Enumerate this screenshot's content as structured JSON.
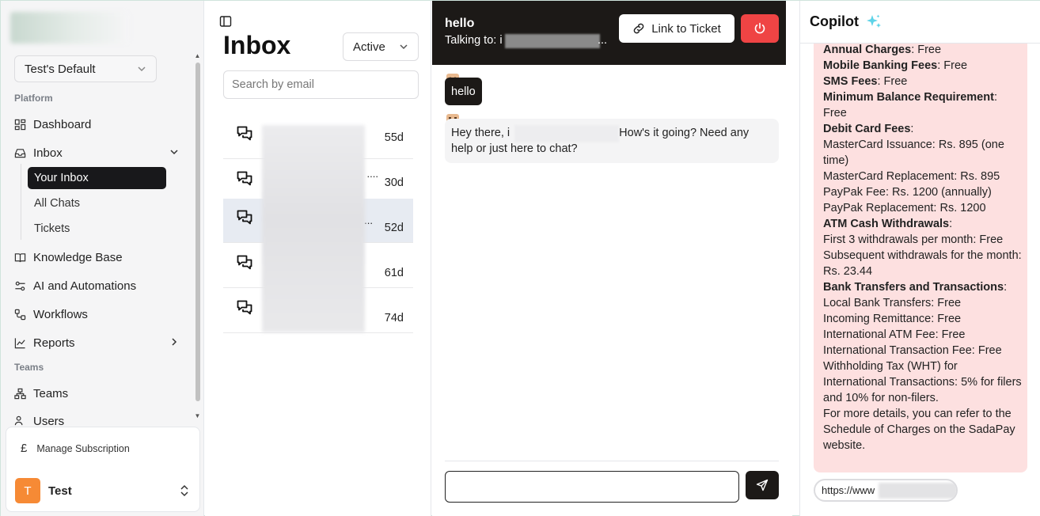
{
  "sidebar": {
    "workspace": "Test's Default",
    "platform_label": "Platform",
    "items": [
      {
        "label": "Dashboard"
      },
      {
        "label": "Inbox"
      },
      {
        "label": "Knowledge Base"
      },
      {
        "label": "AI and Automations"
      },
      {
        "label": "Workflows"
      },
      {
        "label": "Reports"
      }
    ],
    "inbox_sub": [
      {
        "label": "Your Inbox"
      },
      {
        "label": "All Chats"
      },
      {
        "label": "Tickets"
      }
    ],
    "teams_label": "Teams",
    "teams_items": [
      {
        "label": "Teams"
      },
      {
        "label": "Users"
      }
    ],
    "manage_subscription": "Manage Subscription",
    "user": {
      "initial": "T",
      "name": "Test"
    }
  },
  "inbox": {
    "title": "Inbox",
    "status_filter": "Active",
    "search_placeholder": "Search by email",
    "chats": [
      {
        "age": "55d",
        "truncated": ""
      },
      {
        "age": "30d",
        "truncated": "...."
      },
      {
        "age": "52d",
        "truncated": "..."
      },
      {
        "age": "61d",
        "truncated": ""
      },
      {
        "age": "74d",
        "truncated": ""
      }
    ]
  },
  "chat": {
    "title": "hello",
    "talking_prefix": "Talking to: i",
    "talking_suffix": "...",
    "link_ticket_label": "Link to Ticket",
    "messages": {
      "user": "hello",
      "bot_prefix": "Hey there, i",
      "bot_suffix": "How's it going? Need any help or just here to chat?"
    }
  },
  "copilot": {
    "title": "Copilot",
    "lines": [
      {
        "bold": "Annual Charges",
        "rest": ": Free"
      },
      {
        "bold": "Mobile Banking Fees",
        "rest": ": Free"
      },
      {
        "bold": "SMS Fees",
        "rest": ": Free"
      },
      {
        "bold": "Minimum Balance Requirement",
        "rest": ": Free"
      },
      {
        "bold": "Debit Card Fees",
        "rest": ":"
      },
      {
        "bold": "",
        "rest": "MasterCard Issuance: Rs. 895 (one time)"
      },
      {
        "bold": "",
        "rest": "MasterCard Replacement: Rs. 895"
      },
      {
        "bold": "",
        "rest": "PayPak Fee: Rs. 1200 (annually)"
      },
      {
        "bold": "",
        "rest": "PayPak Replacement: Rs. 1200"
      },
      {
        "bold": "ATM Cash Withdrawals",
        "rest": ":"
      },
      {
        "bold": "",
        "rest": "First 3 withdrawals per month: Free"
      },
      {
        "bold": "",
        "rest": "Subsequent withdrawals for the month: Rs. 23.44"
      },
      {
        "bold": "Bank Transfers and Transactions",
        "rest": ":"
      },
      {
        "bold": "",
        "rest": "Local Bank Transfers: Free"
      },
      {
        "bold": "",
        "rest": "Incoming Remittance: Free"
      },
      {
        "bold": "",
        "rest": "International ATM Fee: Free"
      },
      {
        "bold": "",
        "rest": "International Transaction Fee: Free"
      },
      {
        "bold": "",
        "rest": "Withholding Tax (WHT) for International Transactions: 5% for filers and 10% for non-filers."
      },
      {
        "bold": "",
        "rest": "For more details, you can refer to the Schedule of Charges on the SadaPay website."
      }
    ],
    "source_link": "https://www"
  },
  "colors": {
    "accent_dark": "#1c1917",
    "danger": "#ef4444",
    "copilot_bg": "#fde0e0",
    "avatar": "#f68a35"
  }
}
